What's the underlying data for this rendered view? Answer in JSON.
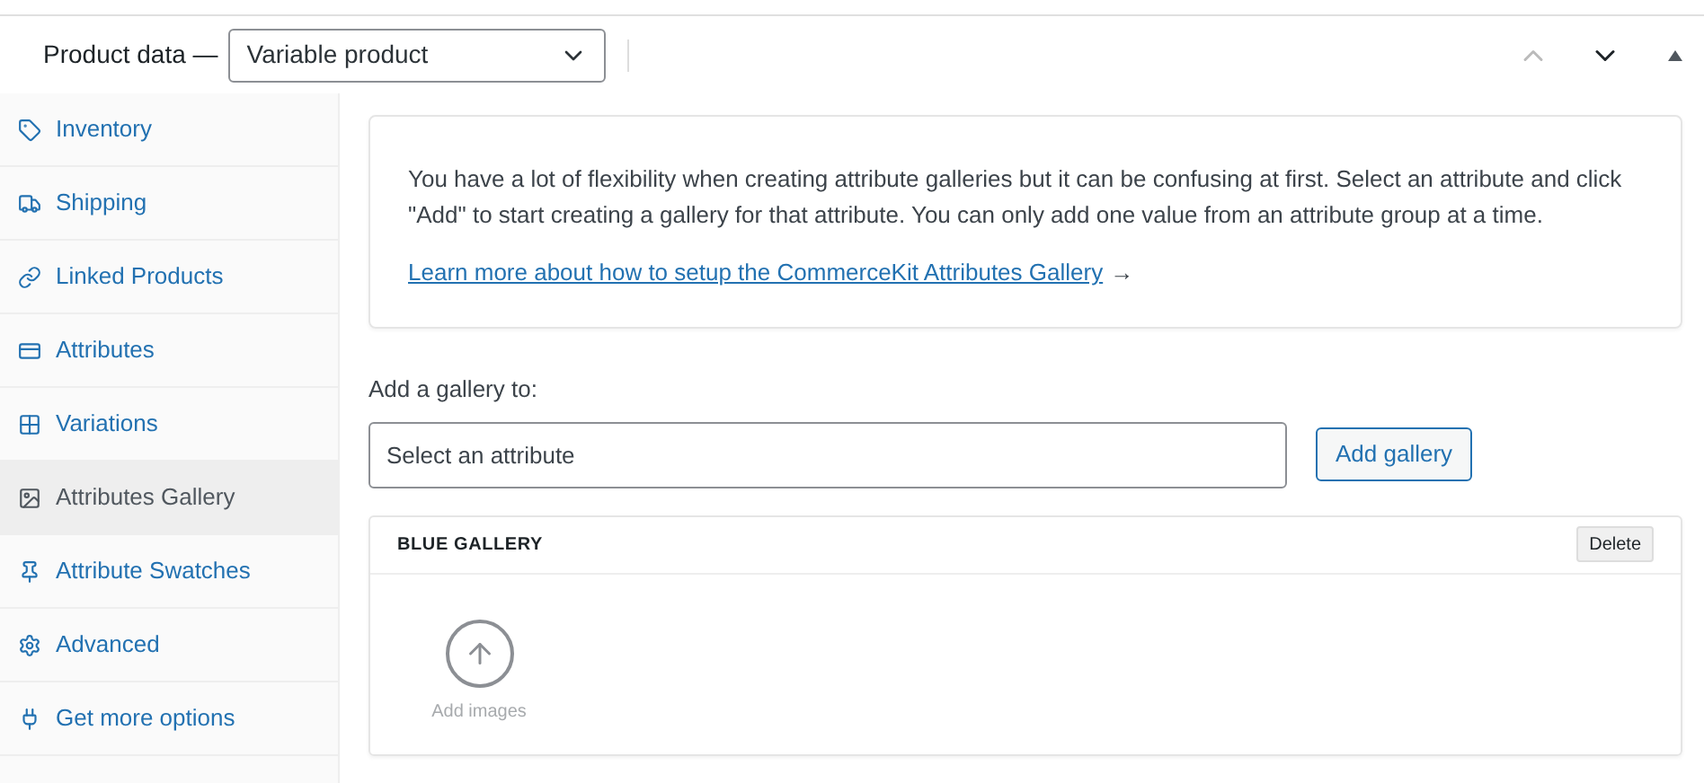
{
  "header": {
    "label": "Product data —",
    "product_type": "Variable product"
  },
  "sidebar": {
    "items": [
      {
        "label": "Inventory",
        "selected": false
      },
      {
        "label": "Shipping",
        "selected": false
      },
      {
        "label": "Linked Products",
        "selected": false
      },
      {
        "label": "Attributes",
        "selected": false
      },
      {
        "label": "Variations",
        "selected": false
      },
      {
        "label": "Attributes Gallery",
        "selected": true
      },
      {
        "label": "Attribute Swatches",
        "selected": false
      },
      {
        "label": "Advanced",
        "selected": false
      },
      {
        "label": "Get more options",
        "selected": false
      }
    ]
  },
  "notice": {
    "text": "You have a lot of flexibility when creating attribute galleries but it can be confusing at first. Select an attribute and click \"Add\" to start creating a gallery for that attribute. You can only add one value from an attribute group at a time.",
    "link": "Learn more about how to setup the CommerceKit Attributes Gallery",
    "arrow": "→"
  },
  "add_gallery": {
    "label": "Add a gallery to:",
    "placeholder": "Select an attribute",
    "button": "Add gallery"
  },
  "galleries": [
    {
      "title": "BLUE GALLERY",
      "delete": "Delete",
      "add_images": "Add images"
    }
  ]
}
